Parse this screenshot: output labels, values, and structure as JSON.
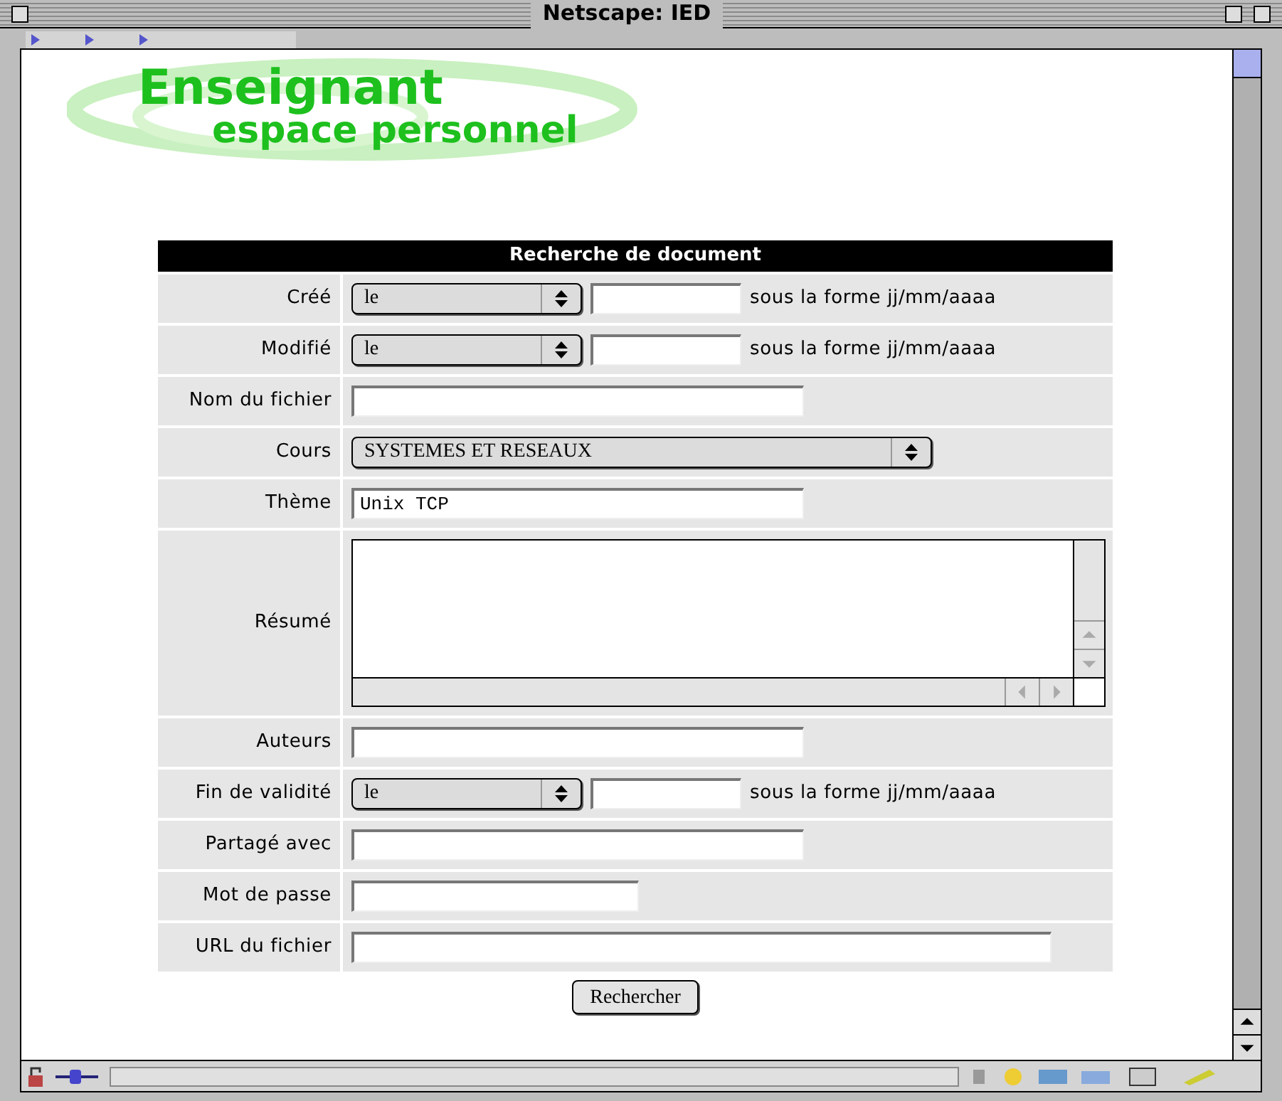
{
  "window": {
    "title": "Netscape: IED"
  },
  "logo": {
    "title": "Enseignant",
    "subtitle": "espace personnel"
  },
  "form": {
    "title": "Recherche de document",
    "rows": [
      {
        "kind": "date",
        "label": "Créé",
        "operator": "le",
        "hint": "sous la forme jj/mm/aaaa"
      },
      {
        "kind": "date",
        "label": "Modifié",
        "operator": "le",
        "hint": "sous la forme jj/mm/aaaa"
      },
      {
        "kind": "text",
        "label": "Nom du fichier"
      },
      {
        "kind": "select",
        "label": "Cours",
        "value": "SYSTEMES ET RESEAUX"
      },
      {
        "kind": "text",
        "label": "Thème",
        "value": "Unix TCP"
      },
      {
        "kind": "textarea",
        "label": "Résumé"
      },
      {
        "kind": "text",
        "label": "Auteurs"
      },
      {
        "kind": "date",
        "label": "Fin de validité",
        "operator": "le",
        "hint": "sous la forme jj/mm/aaaa"
      },
      {
        "kind": "text",
        "label": "Partagé avec"
      },
      {
        "kind": "short_text",
        "label": "Mot de passe"
      },
      {
        "kind": "long_text",
        "label": "URL du fichier"
      }
    ],
    "submit": "Rechercher"
  }
}
